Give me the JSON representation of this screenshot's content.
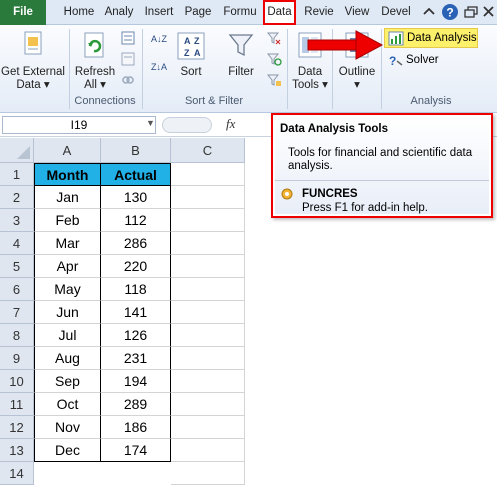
{
  "tabs": [
    "File",
    "Home",
    "Analy",
    "Insert",
    "Page",
    "Formu",
    "Data",
    "Revie",
    "View",
    "Devel"
  ],
  "ribbon": {
    "get_external_data": [
      "Get External",
      "Data ▾"
    ],
    "refresh_all": [
      "Refresh",
      "All ▾"
    ],
    "connections_label": "Connections",
    "sort": "Sort",
    "filter": "Filter",
    "sort_filter_label": "Sort & Filter",
    "data_tools": [
      "Data",
      "Tools ▾"
    ],
    "outline": [
      "Outline",
      "▾"
    ],
    "data_analysis": "Data Analysis",
    "solver": "Solver",
    "analysis_label": "Analysis",
    "sort_az": "A↓Z",
    "sort_za": "Z↓A"
  },
  "formula_bar": {
    "name_box": "I19",
    "fx": "fx"
  },
  "tooltip": {
    "title": "Data Analysis Tools",
    "description": "Tools for financial and scientific data analysis.",
    "addin_title": "FUNCRES",
    "addin_help": "Press F1 for add-in help."
  },
  "sheet": {
    "columns": [
      "A",
      "B",
      "C"
    ],
    "rows": [
      "1",
      "2",
      "3",
      "4",
      "5",
      "6",
      "7",
      "8",
      "9",
      "10",
      "11",
      "12",
      "13",
      "14"
    ],
    "headers": [
      "Month",
      "Actual"
    ],
    "data": [
      [
        "Jan",
        "130"
      ],
      [
        "Feb",
        "112"
      ],
      [
        "Mar",
        "286"
      ],
      [
        "Apr",
        "220"
      ],
      [
        "May",
        "118"
      ],
      [
        "Jun",
        "141"
      ],
      [
        "Jul",
        "126"
      ],
      [
        "Aug",
        "231"
      ],
      [
        "Sep",
        "194"
      ],
      [
        "Oct",
        "289"
      ],
      [
        "Nov",
        "186"
      ],
      [
        "Dec",
        "174"
      ]
    ]
  },
  "colors": {
    "header_fill": "#22b1e6",
    "highlight": "#ff0000",
    "file_tab": "#2a7a3c"
  }
}
